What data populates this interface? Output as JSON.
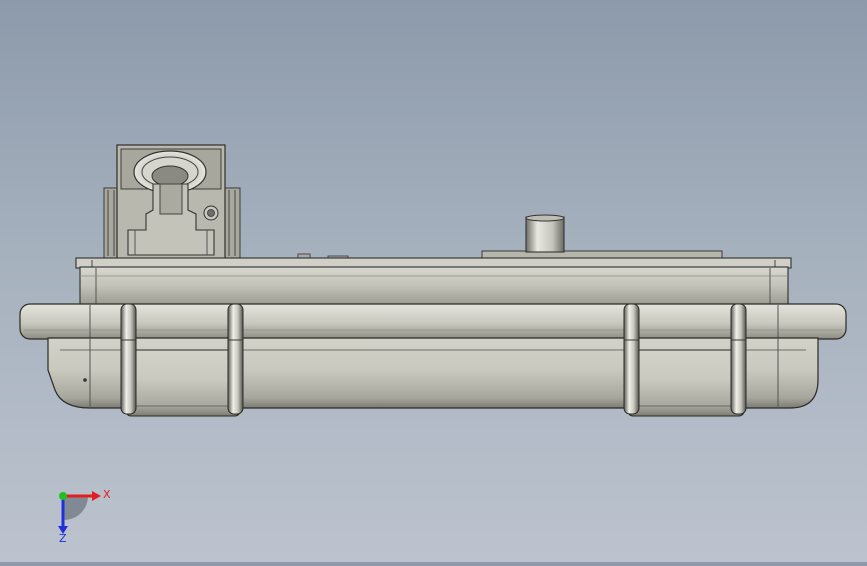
{
  "viewport": {
    "background_top": "#8c9aab",
    "background_bottom": "#bcc3ce",
    "model_metal_color": "#c8c8c0"
  },
  "triad": {
    "x_label": "X",
    "z_label": "Z",
    "x_color": "#e02020",
    "y_color": "#20c020",
    "z_color": "#2030e0"
  }
}
